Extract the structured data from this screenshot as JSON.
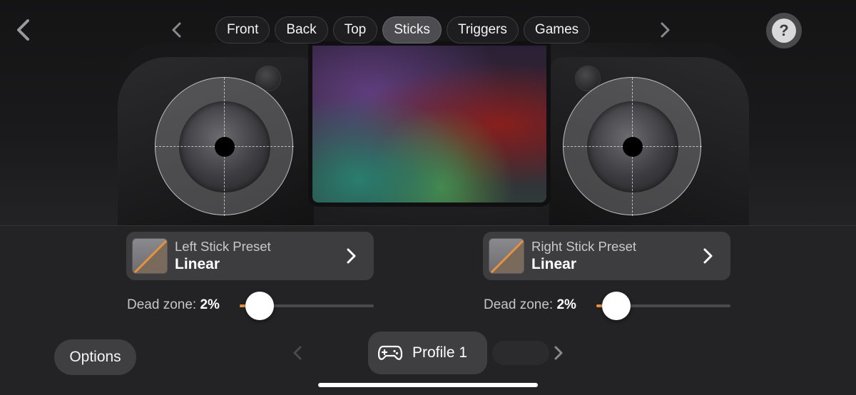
{
  "nav": {
    "back_icon": "chevron-left-icon",
    "tabs": [
      {
        "label": "Front",
        "active": false
      },
      {
        "label": "Back",
        "active": false
      },
      {
        "label": "Top",
        "active": false
      },
      {
        "label": "Sticks",
        "active": true
      },
      {
        "label": "Triggers",
        "active": false
      },
      {
        "label": "Games",
        "active": false
      }
    ],
    "help_label": "?"
  },
  "left_stick": {
    "preset_title": "Left Stick Preset",
    "preset_value": "Linear",
    "dead_zone_label": "Dead zone:",
    "dead_zone_value": "2%",
    "dead_zone_percent": 2
  },
  "right_stick": {
    "preset_title": "Right Stick Preset",
    "preset_value": "Linear",
    "dead_zone_label": "Dead zone:",
    "dead_zone_value": "2%",
    "dead_zone_percent": 2
  },
  "bottom": {
    "options_label": "Options",
    "profile_label": "Profile 1",
    "profile_icon": "gamepad-icon"
  },
  "colors": {
    "accent": "#e8923a",
    "tab_active": "#505054",
    "card": "#3d3d40",
    "panel": "#232325"
  }
}
